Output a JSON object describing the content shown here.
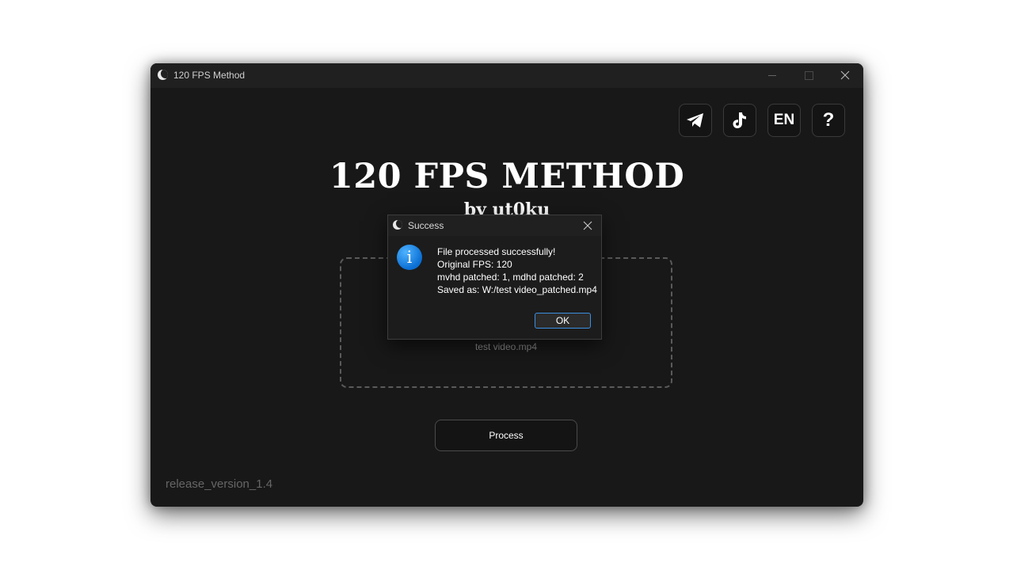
{
  "window": {
    "title": "120 FPS Method"
  },
  "header_buttons": {
    "language": "EN",
    "help": "?"
  },
  "main": {
    "title": "120 FPS METHOD",
    "subtitle": "by ut0ku",
    "file_name": "test video.mp4",
    "process_label": "Process",
    "version": "release_version_1.4"
  },
  "dialog": {
    "title": "Success",
    "lines": [
      "File processed successfully!",
      "Original FPS: 120",
      "mvhd patched: 1, mdhd patched: 2",
      "Saved as: W:/test video_patched.mp4"
    ],
    "ok_label": "OK"
  },
  "colors": {
    "window_bg": "#181818",
    "titlebar_bg": "#202020",
    "accent_blue": "#3c8fe0",
    "info_icon": "#0a6fd4"
  },
  "icons": [
    "app-moon-icon",
    "telegram-icon",
    "tiktok-icon",
    "info-icon",
    "close-icon"
  ]
}
